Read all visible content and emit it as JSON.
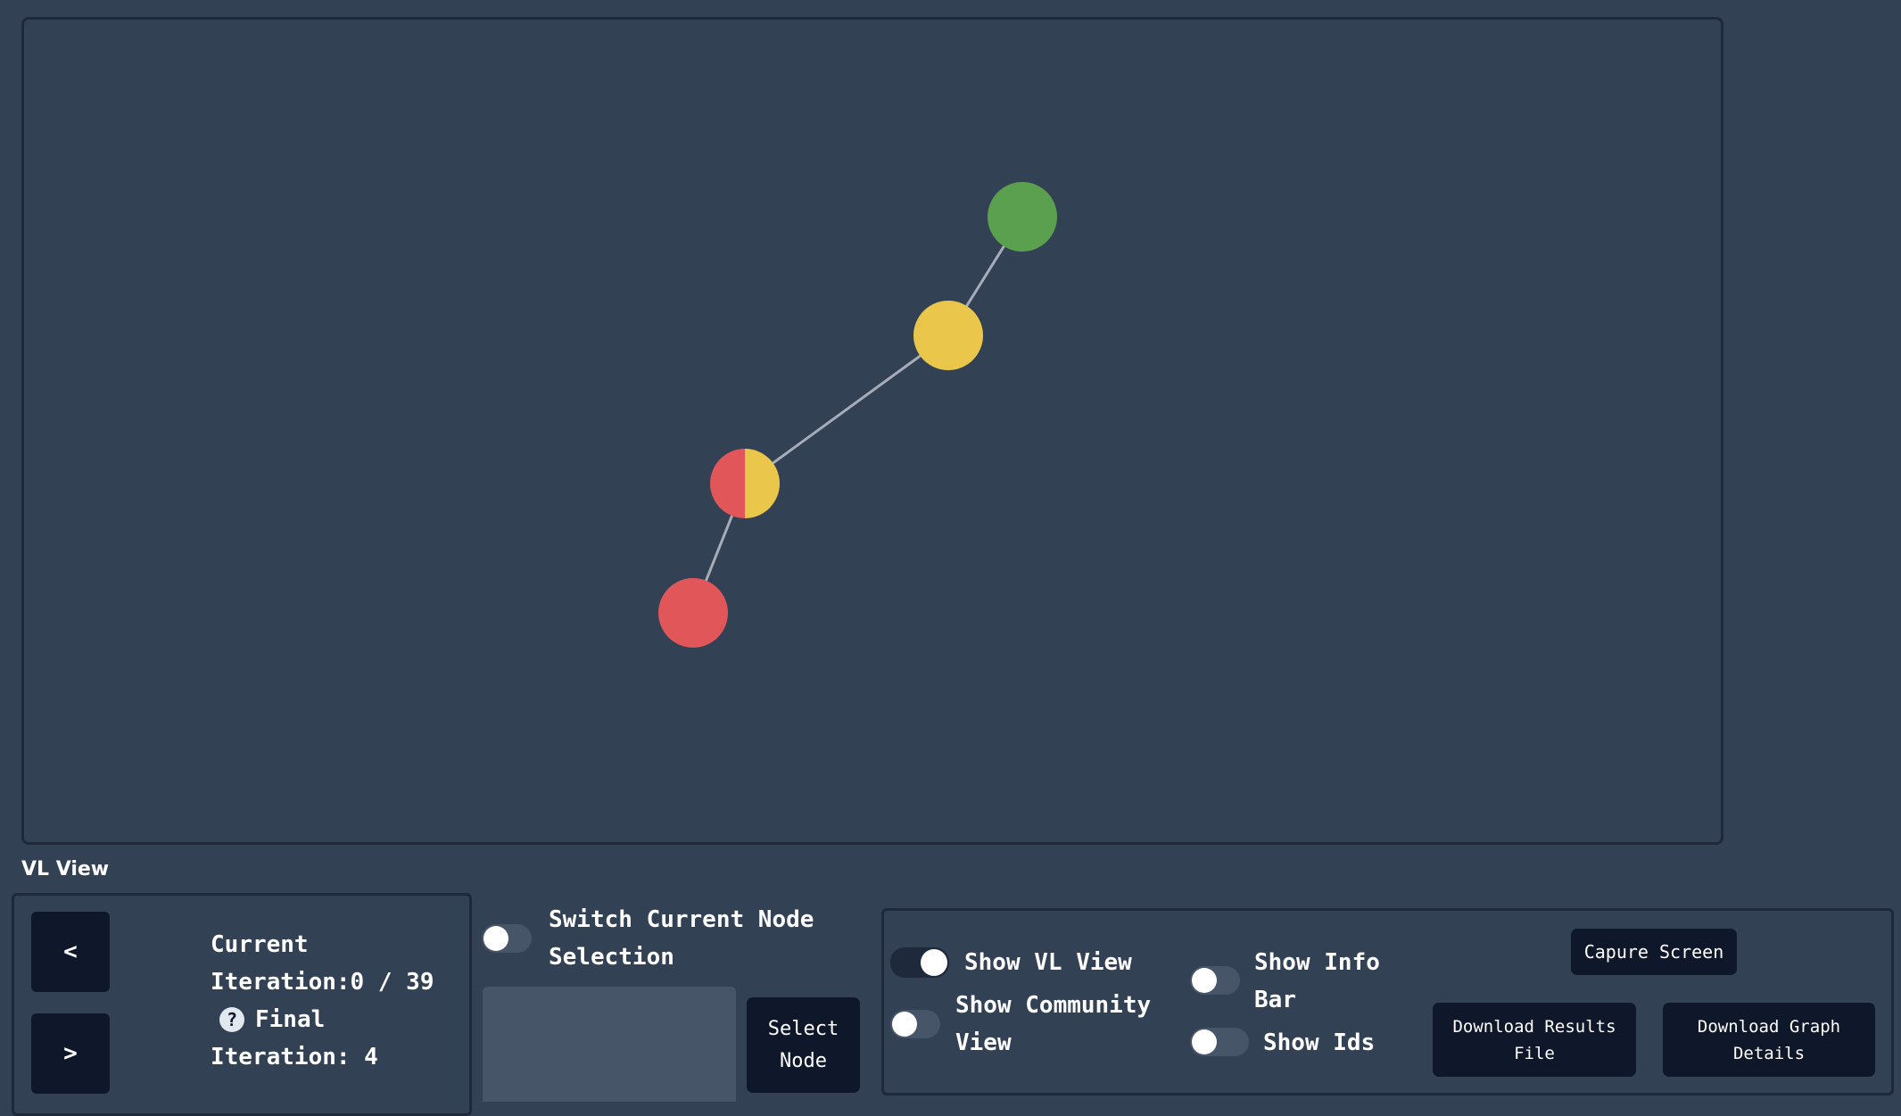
{
  "graph": {
    "nodes": [
      {
        "id": "n1",
        "colors": [
          "#5ba04e"
        ]
      },
      {
        "id": "n2",
        "colors": [
          "#eac74a"
        ]
      },
      {
        "id": "n3",
        "colors": [
          "#e15759",
          "#eac74a"
        ]
      },
      {
        "id": "n4",
        "colors": [
          "#e15759"
        ]
      }
    ],
    "edges": [
      [
        "n1",
        "n2"
      ],
      [
        "n2",
        "n3"
      ],
      [
        "n3",
        "n4"
      ]
    ],
    "edge_color": "#a7adb8"
  },
  "view_label": "VL View",
  "iteration": {
    "prev_label": "<",
    "next_label": ">",
    "current_label": "Current",
    "iteration_label": "Iteration:",
    "current_value": "0 / 39",
    "help_icon": "?",
    "final_label": "Final",
    "final_iteration": "Iteration: 4"
  },
  "node_selection": {
    "switch_label_line1": "Switch Current Node",
    "switch_label_line2": "Selection",
    "switch_on": false,
    "select_label_line1": "Select",
    "select_label_line2": "Node"
  },
  "options": {
    "show_vl_view": {
      "label": "Show VL View",
      "on": true
    },
    "show_community_view": {
      "line1": "Show Community",
      "line2": "View",
      "on": false
    },
    "show_info_bar": {
      "line1": "Show Info",
      "line2": "Bar",
      "on": false
    },
    "show_ids": {
      "label": "Show Ids",
      "on": false
    }
  },
  "buttons": {
    "capture": "Capure Screen",
    "download_results_line1": "Download Results",
    "download_results_line2": "File",
    "download_graph_line1": "Download Graph",
    "download_graph_line2": "Details"
  }
}
